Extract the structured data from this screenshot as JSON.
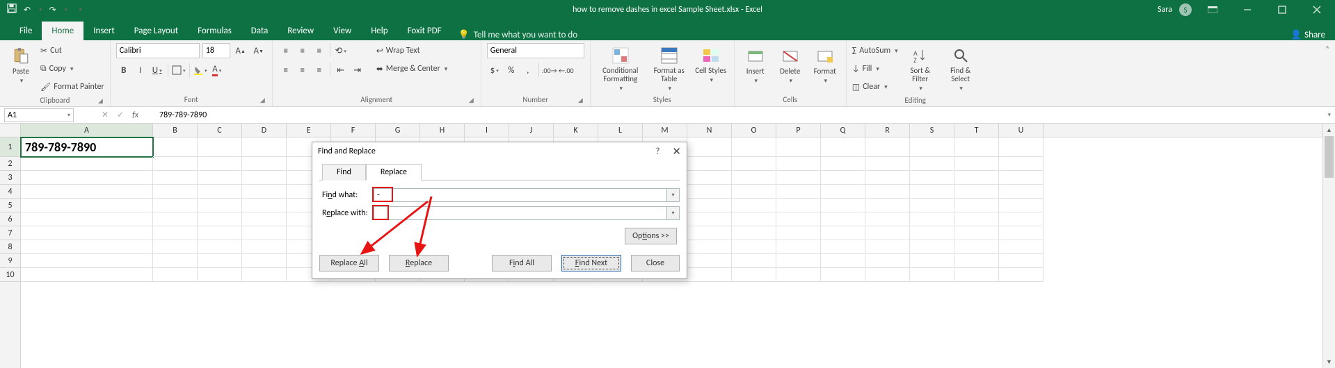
{
  "title": {
    "docname": "how to remove dashes in excel Sample Sheet.xlsx  -  Excel",
    "user": "Sara",
    "user_initial": "S"
  },
  "qat": {
    "save": "💾",
    "undo": "↶",
    "redo": "↷",
    "touch": "",
    "more": "▾"
  },
  "tabs": [
    "File",
    "Home",
    "Insert",
    "Page Layout",
    "Formulas",
    "Data",
    "Review",
    "View",
    "Help",
    "Foxit PDF"
  ],
  "tellme_placeholder": "Tell me what you want to do",
  "share": "Share",
  "ribbon": {
    "clipboard": {
      "paste": "Paste",
      "cut": "Cut",
      "copy": "Copy",
      "formatpainter": "Format Painter",
      "label": "Clipboard"
    },
    "font": {
      "name": "Calibri",
      "size": "18",
      "bold": "B",
      "italic": "I",
      "underline": "U",
      "label": "Font"
    },
    "alignment": {
      "wrap": "Wrap Text",
      "merge": "Merge & Center",
      "label": "Alignment"
    },
    "number": {
      "format": "General",
      "label": "Number"
    },
    "styles": {
      "cf": "Conditional Formatting",
      "fat": "Format as Table",
      "cs": "Cell Styles",
      "label": "Styles"
    },
    "cells": {
      "insert": "Insert",
      "delete": "Delete",
      "format": "Format",
      "label": "Cells"
    },
    "editing": {
      "autosum": "AutoSum",
      "fill": "Fill",
      "clear": "Clear",
      "sort": "Sort & Filter",
      "find": "Find & Select",
      "label": "Editing"
    }
  },
  "formula_bar": {
    "namebox": "A1",
    "formula": "789-789-7890"
  },
  "grid": {
    "columns": [
      "A",
      "B",
      "C",
      "D",
      "E",
      "F",
      "G",
      "H",
      "I",
      "J",
      "K",
      "L",
      "M",
      "N",
      "O",
      "P",
      "Q",
      "R",
      "S",
      "T",
      "U"
    ],
    "colA_width": 190,
    "other_col_width": 64,
    "rows": [
      1,
      2,
      3,
      4,
      5,
      6,
      7,
      8,
      9,
      10
    ],
    "cells": {
      "A1": "789-789-7890"
    }
  },
  "dialog": {
    "title": "Find and Replace",
    "tabs": {
      "find": "Find",
      "replace": "Replace"
    },
    "find_label": "Find what:",
    "find_value": "-",
    "replace_label": "Replace with:",
    "replace_value": "",
    "options": "Options >>",
    "btn_replace_all": "Replace All",
    "btn_replace": "Replace",
    "btn_find_all": "Find All",
    "btn_find_next": "Find Next",
    "btn_close": "Close"
  }
}
